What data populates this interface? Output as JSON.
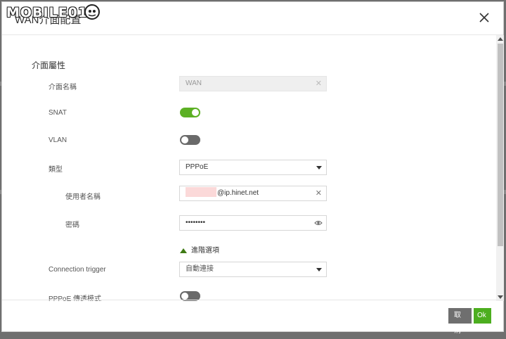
{
  "watermark": "MOBILE01",
  "dialog": {
    "title": "WAN介面配置",
    "close_icon": "close-icon"
  },
  "section": {
    "title": "介面屬性"
  },
  "fields": {
    "interface_name": {
      "label": "介面名稱",
      "value": "WAN"
    },
    "snat": {
      "label": "SNAT",
      "state": "on"
    },
    "vlan": {
      "label": "VLAN",
      "state": "off"
    },
    "type": {
      "label": "類型",
      "value": "PPPoE"
    },
    "username": {
      "label": "使用者名稱",
      "value": "@ip.hinet.net"
    },
    "password": {
      "label": "密碼",
      "value": "••••••••"
    },
    "advanced": {
      "label": "進階選項"
    },
    "connection_trigger": {
      "label": "Connection trigger",
      "value": "自動連接"
    },
    "pppoe_passthrough": {
      "label": "PPPoE 傳透模式",
      "state": "off"
    }
  },
  "footer": {
    "cancel_label": "取消",
    "ok_label": "Ok"
  },
  "colors": {
    "toggle_on": "#5cb024",
    "toggle_off": "#6a6a6a",
    "ok_button": "#4cae1f",
    "cancel_button": "#6f6f6f"
  }
}
